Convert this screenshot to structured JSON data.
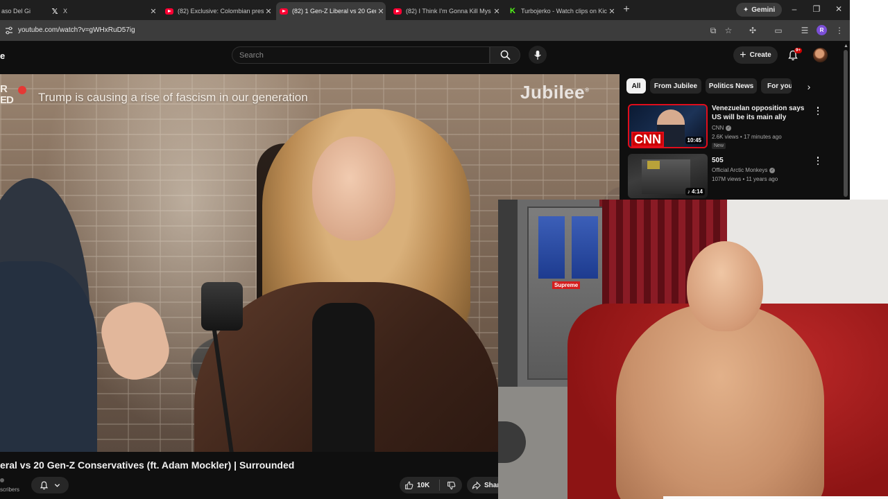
{
  "browser": {
    "tabs": [
      {
        "title": "aso Del Gi",
        "favicon": "partial-tab",
        "active": false
      },
      {
        "title": "X",
        "favicon": "x-icon",
        "active": false
      },
      {
        "title": "(82) Exclusive: Colombian presi",
        "favicon": "youtube-icon",
        "active": false
      },
      {
        "title": "(82) 1 Gen-Z Liberal vs 20 Gen",
        "favicon": "youtube-icon",
        "active": true
      },
      {
        "title": "(82) I Think I'm Gonna Kill Mys",
        "favicon": "youtube-icon",
        "active": false
      },
      {
        "title": "Turbojerko - Watch clips on Kic",
        "favicon": "kick-icon",
        "active": false
      }
    ],
    "new_tab": "+",
    "gemini_label": "Gemini",
    "window_controls": {
      "minimize": "–",
      "restore": "❐",
      "close": "✕"
    },
    "url": "youtube.com/watch?v=gWHxRuD57ig",
    "profile_initial": "R"
  },
  "youtube": {
    "logo_tail": "e",
    "search": {
      "placeholder": "Search"
    },
    "create_label": "Create",
    "notification_count": "9+",
    "filter_chips": [
      {
        "label": "All",
        "active": true
      },
      {
        "label": "From Jubilee",
        "active": false
      },
      {
        "label": "Politics News",
        "active": false
      },
      {
        "label": "For you",
        "active": false
      }
    ],
    "player": {
      "corner_logo": "R\nED",
      "caption": "Trump is causing a rise of fascism in our generation",
      "watermark": "Jubilee"
    },
    "video": {
      "title": "eral vs 20 Gen-Z Conservatives (ft. Adam Mockler) | Surrounded",
      "subscribers_fragment": "scribers",
      "likes": "10K",
      "share_label": "Shar"
    },
    "recommendations": [
      {
        "title": "Venezuelan opposition says US will be its main ally",
        "channel": "CNN",
        "verified": true,
        "views": "2.6K views",
        "age": "17 minutes ago",
        "badge": "New",
        "duration": "10:45",
        "thumb_text": "CNN"
      },
      {
        "title": "505",
        "channel": "Official Arctic Monkeys",
        "verified": true,
        "views": "107M views",
        "age": "11 years ago",
        "badge": "",
        "duration": "4:14"
      }
    ]
  },
  "webcam": {
    "sign_text": "Supreme"
  }
}
